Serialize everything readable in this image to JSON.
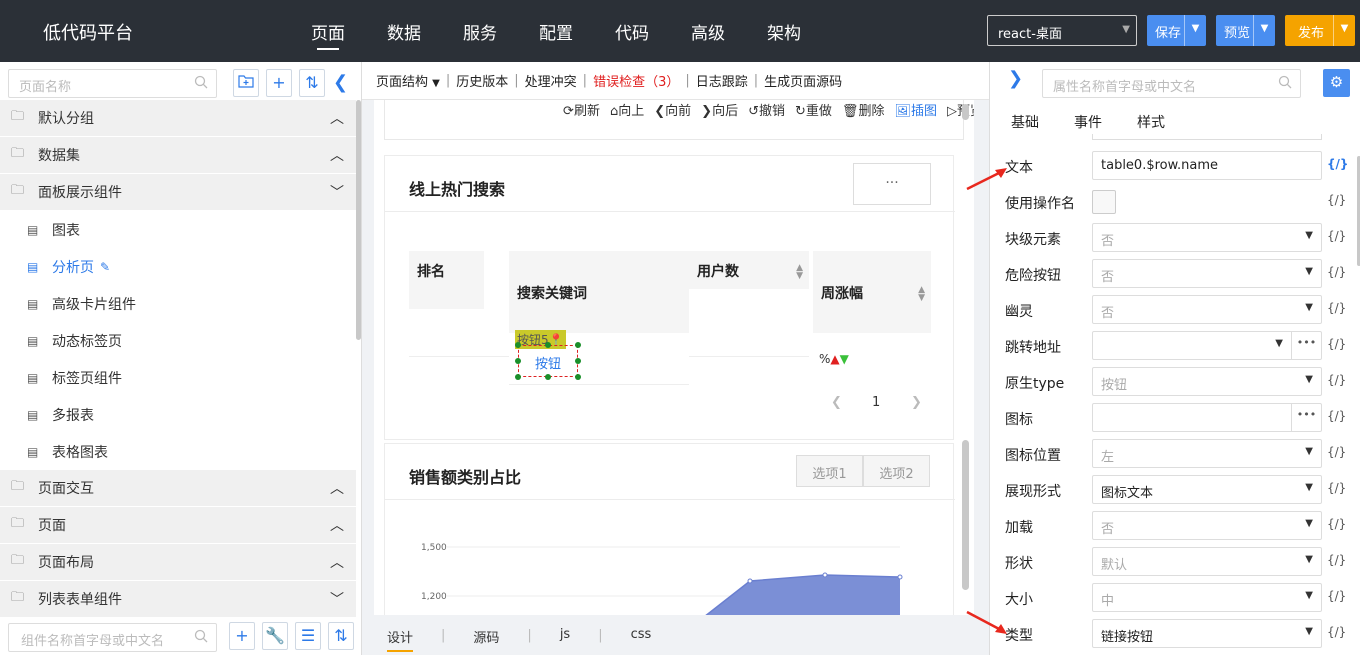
{
  "header": {
    "logo": "低代码平台",
    "nav": [
      "页面",
      "数据",
      "服务",
      "配置",
      "代码",
      "高级",
      "架构"
    ],
    "platform_select": "react-桌面",
    "save": "保存",
    "preview": "预览",
    "publish": "发布",
    "colors": {
      "bg": "#2b3037",
      "blue": "#4a8ef0",
      "orange": "#f5a300"
    }
  },
  "left": {
    "search_placeholder": "页面名称",
    "groups_top": [
      {
        "label": "默认分组",
        "chevron": "up"
      },
      {
        "label": "数据集",
        "chevron": "up"
      },
      {
        "label": "面板展示组件",
        "chevron": "down"
      }
    ],
    "items": [
      "图表",
      "分析页",
      "高级卡片组件",
      "动态标签页",
      "标签页组件",
      "多报表",
      "表格图表"
    ],
    "active_item": "分析页",
    "groups_bottom": [
      {
        "label": "页面交互",
        "chevron": "up"
      },
      {
        "label": "页面",
        "chevron": "up"
      },
      {
        "label": "页面布局",
        "chevron": "up"
      },
      {
        "label": "列表表单组件",
        "chevron": "down"
      }
    ],
    "bottom_search_placeholder": "组件名称首字母或中文名"
  },
  "center": {
    "toolbar": {
      "page_structure": "页面结构",
      "history": "历史版本",
      "conflict": "处理冲突",
      "error_check": "错误检查（3）",
      "log": "日志跟踪",
      "gen_source": "生成页面源码"
    },
    "actions": [
      "刷新",
      "向上",
      "向前",
      "向后",
      "撤销",
      "重做",
      "删除",
      "插图",
      "预览"
    ],
    "card_hot_search": {
      "title": "线上热门搜索",
      "more": "···",
      "columns": [
        "排名",
        "搜索关键词",
        "用户数",
        "周涨幅"
      ],
      "badge": "按钮5",
      "button": "按钮",
      "percent": "%",
      "page": "1"
    },
    "card_sales": {
      "title": "销售额类别占比",
      "tabs": [
        "选项1",
        "选项2"
      ],
      "y_ticks": [
        "1,500",
        "1,200"
      ]
    },
    "bottom_tabs": [
      "设计",
      "源码",
      "js",
      "css"
    ]
  },
  "right": {
    "search_placeholder": "属性名称首字母或中文名",
    "tabs": [
      "基础",
      "事件",
      "样式"
    ],
    "props": [
      {
        "label": "文本",
        "value": "table0.$row.name",
        "type": "text"
      },
      {
        "label": "使用操作名",
        "value": "",
        "type": "check"
      },
      {
        "label": "块级元素",
        "value": "否",
        "type": "select"
      },
      {
        "label": "危险按钮",
        "value": "否",
        "type": "select"
      },
      {
        "label": "幽灵",
        "value": "否",
        "type": "select"
      },
      {
        "label": "跳转地址",
        "value": "",
        "type": "select-more"
      },
      {
        "label": "原生type",
        "value": "按钮",
        "type": "select"
      },
      {
        "label": "图标",
        "value": "",
        "type": "more"
      },
      {
        "label": "图标位置",
        "value": "左",
        "type": "select"
      },
      {
        "label": "展现形式",
        "value": "图标文本",
        "type": "select-strong"
      },
      {
        "label": "加载",
        "value": "否",
        "type": "select"
      },
      {
        "label": "形状",
        "value": "默认",
        "type": "select"
      },
      {
        "label": "大小",
        "value": "中",
        "type": "select"
      },
      {
        "label": "类型",
        "value": "链接按钮",
        "type": "select-strong"
      }
    ],
    "code_marker": "{/}"
  }
}
